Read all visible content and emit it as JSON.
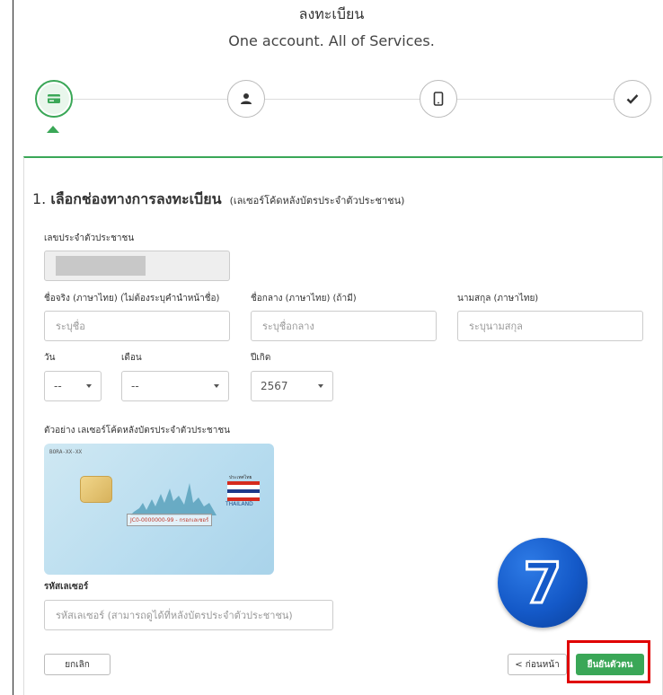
{
  "header": {
    "title": "ลงทะเบียน",
    "subtitle": "One account. All of Services."
  },
  "steps": [
    {
      "icon": "id-card-icon",
      "active": true
    },
    {
      "icon": "user-icon",
      "active": false
    },
    {
      "icon": "mobile-icon",
      "active": false
    },
    {
      "icon": "check-icon",
      "active": false
    }
  ],
  "section": {
    "number": "1.",
    "title": "เลือกช่องทางการลงทะเบียน",
    "subtitle": "(เลเซอร์โค้ดหลังบัตรประจำตัวประชาชน)"
  },
  "form": {
    "citizen_id_label": "เลขประจำตัวประชาชน",
    "first_name_label": "ชื่อจริง (ภาษาไทย) (ไม่ต้องระบุคำนำหน้าชื่อ)",
    "first_name_placeholder": "ระบุชื่อ",
    "middle_name_label": "ชื่อกลาง (ภาษาไทย) (ถ้ามี)",
    "middle_name_placeholder": "ระบุชื่อกลาง",
    "last_name_label": "นามสกุล (ภาษาไทย)",
    "last_name_placeholder": "ระบุนามสกุล",
    "day_label": "วัน",
    "day_value": "--",
    "month_label": "เดือน",
    "month_value": "--",
    "year_label": "ปีเกิด",
    "year_value": "2567",
    "example_label": "ตัวอย่าง เลเซอร์โค้ดหลังบัตรประจำตัวประชาชน",
    "laser_label": "รหัสเลเซอร์",
    "laser_placeholder": "รหัสเลเซอร์ (สามารถดูได้ที่หลังบัตรประจำตัวประชาชน)"
  },
  "card_example": {
    "code": "BORA-XX-XX",
    "laser_sample": "JC0-0000000-99",
    "laser_hint": "กรอกเลเซอร์",
    "country": "THAILAND",
    "word": "ประเทศไทย"
  },
  "buttons": {
    "cancel": "ยกเลิก",
    "back": "< ก่อนหน้า",
    "confirm": "ยืนยันตัวตน"
  },
  "badge": {
    "value": "7"
  },
  "colors": {
    "accent": "#3aa757",
    "highlight": "#e00000",
    "badge": "#1459c8"
  }
}
